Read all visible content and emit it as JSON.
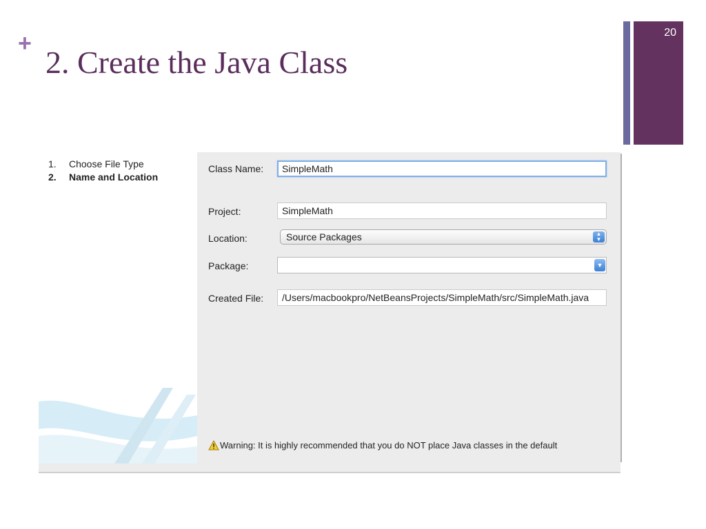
{
  "slide": {
    "plus_mark": "+",
    "title": "2. Create the Java Class",
    "number": "20"
  },
  "dialog": {
    "steps": [
      {
        "num": "1.",
        "label": "Choose File Type",
        "current": false
      },
      {
        "num": "2.",
        "label": "Name and Location",
        "current": true
      }
    ],
    "class_name": {
      "label": "Class Name:",
      "value": "SimpleMath"
    },
    "project": {
      "label": "Project:",
      "value": "SimpleMath"
    },
    "location": {
      "label": "Location:",
      "value": "Source Packages"
    },
    "package": {
      "label": "Package:",
      "value": ""
    },
    "created_file": {
      "label": "Created File:",
      "value": "/Users/macbookpro/NetBeansProjects/SimpleMath/src/SimpleMath.java"
    },
    "warning": "Warning: It is highly recommended that you do NOT place Java classes in the default"
  },
  "colors": {
    "title": "#5a2d5c",
    "accent_block": "#63325f",
    "accent_thin": "#6a6a9e",
    "plus": "#9a6fb0"
  }
}
